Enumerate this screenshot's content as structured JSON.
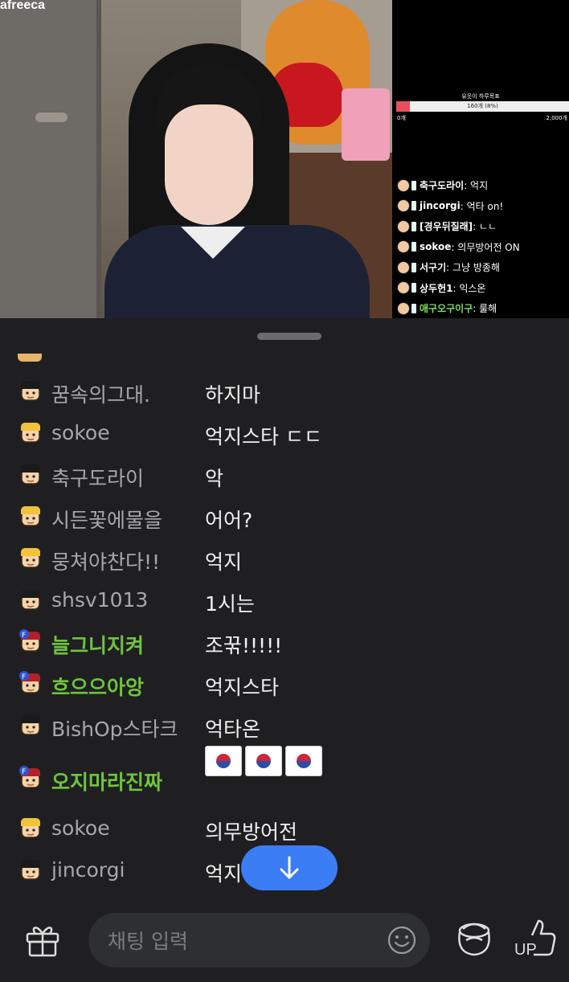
{
  "stream": {
    "logo": "afreeca",
    "goal": {
      "title": "유웃이 하루목표",
      "progress_text": "160개 (8%)",
      "percent": 8,
      "min": "0개",
      "max": "2,000개"
    },
    "overlay_chat": [
      {
        "nick": "축구도라이",
        "msg": "억지",
        "green": false
      },
      {
        "nick": "jincorgi",
        "msg": "억타 on!",
        "green": false
      },
      {
        "nick": "[경우뒤질래]",
        "msg": "ㄴㄴ",
        "green": false
      },
      {
        "nick": "sokoe",
        "msg": "의무방어전 ON",
        "green": false
      },
      {
        "nick": "서구기",
        "msg": "그냥 방종해",
        "green": false
      },
      {
        "nick": "상두헌1",
        "msg": "익스온",
        "green": false
      },
      {
        "nick": "애구오구이구",
        "msg": "룰해",
        "green": true
      }
    ]
  },
  "chat": {
    "messages": [
      {
        "nick": "꿈속의그대.",
        "msg": "하지마",
        "green": false,
        "avatar": "black"
      },
      {
        "nick": "sokoe",
        "msg": "억지스타 ㄷㄷ",
        "green": false,
        "avatar": "blond"
      },
      {
        "nick": "축구도라이",
        "msg": "악",
        "green": false,
        "avatar": "black"
      },
      {
        "nick": "시든꽃에물을",
        "msg": "어어?",
        "green": false,
        "avatar": "blond"
      },
      {
        "nick": "뭉쳐야찬다!!",
        "msg": "억지",
        "green": false,
        "avatar": "blond"
      },
      {
        "nick": "shsv1013",
        "msg": "1시는",
        "green": false,
        "avatar": "black"
      },
      {
        "nick": "늘그니지켜",
        "msg": "조꾺!!!!!",
        "green": true,
        "avatar": "fan"
      },
      {
        "nick": "흐으으아앙",
        "msg": "억지스타",
        "green": true,
        "avatar": "fan"
      },
      {
        "nick": "BishOp스타크",
        "msg": "억타온",
        "green": false,
        "avatar": "black"
      },
      {
        "nick": "오지마라진짜",
        "msg": "",
        "green": true,
        "avatar": "fan",
        "flags": 3
      },
      {
        "nick": "sokoe",
        "msg": "의무방어전",
        "green": false,
        "avatar": "blond"
      },
      {
        "nick": "jincorgi",
        "msg": "억지",
        "green": false,
        "avatar": "black"
      }
    ]
  },
  "input": {
    "placeholder": "채팅 입력"
  },
  "icons": {
    "gift": "gift-icon",
    "emoji": "emoji-icon",
    "balloon": "star-balloon-icon",
    "up": "up-thumb-icon",
    "scroll": "arrow-down-icon"
  },
  "colors": {
    "accent": "#3b7df5",
    "green_nick": "#6fc43e",
    "bg": "#1f1f21"
  }
}
